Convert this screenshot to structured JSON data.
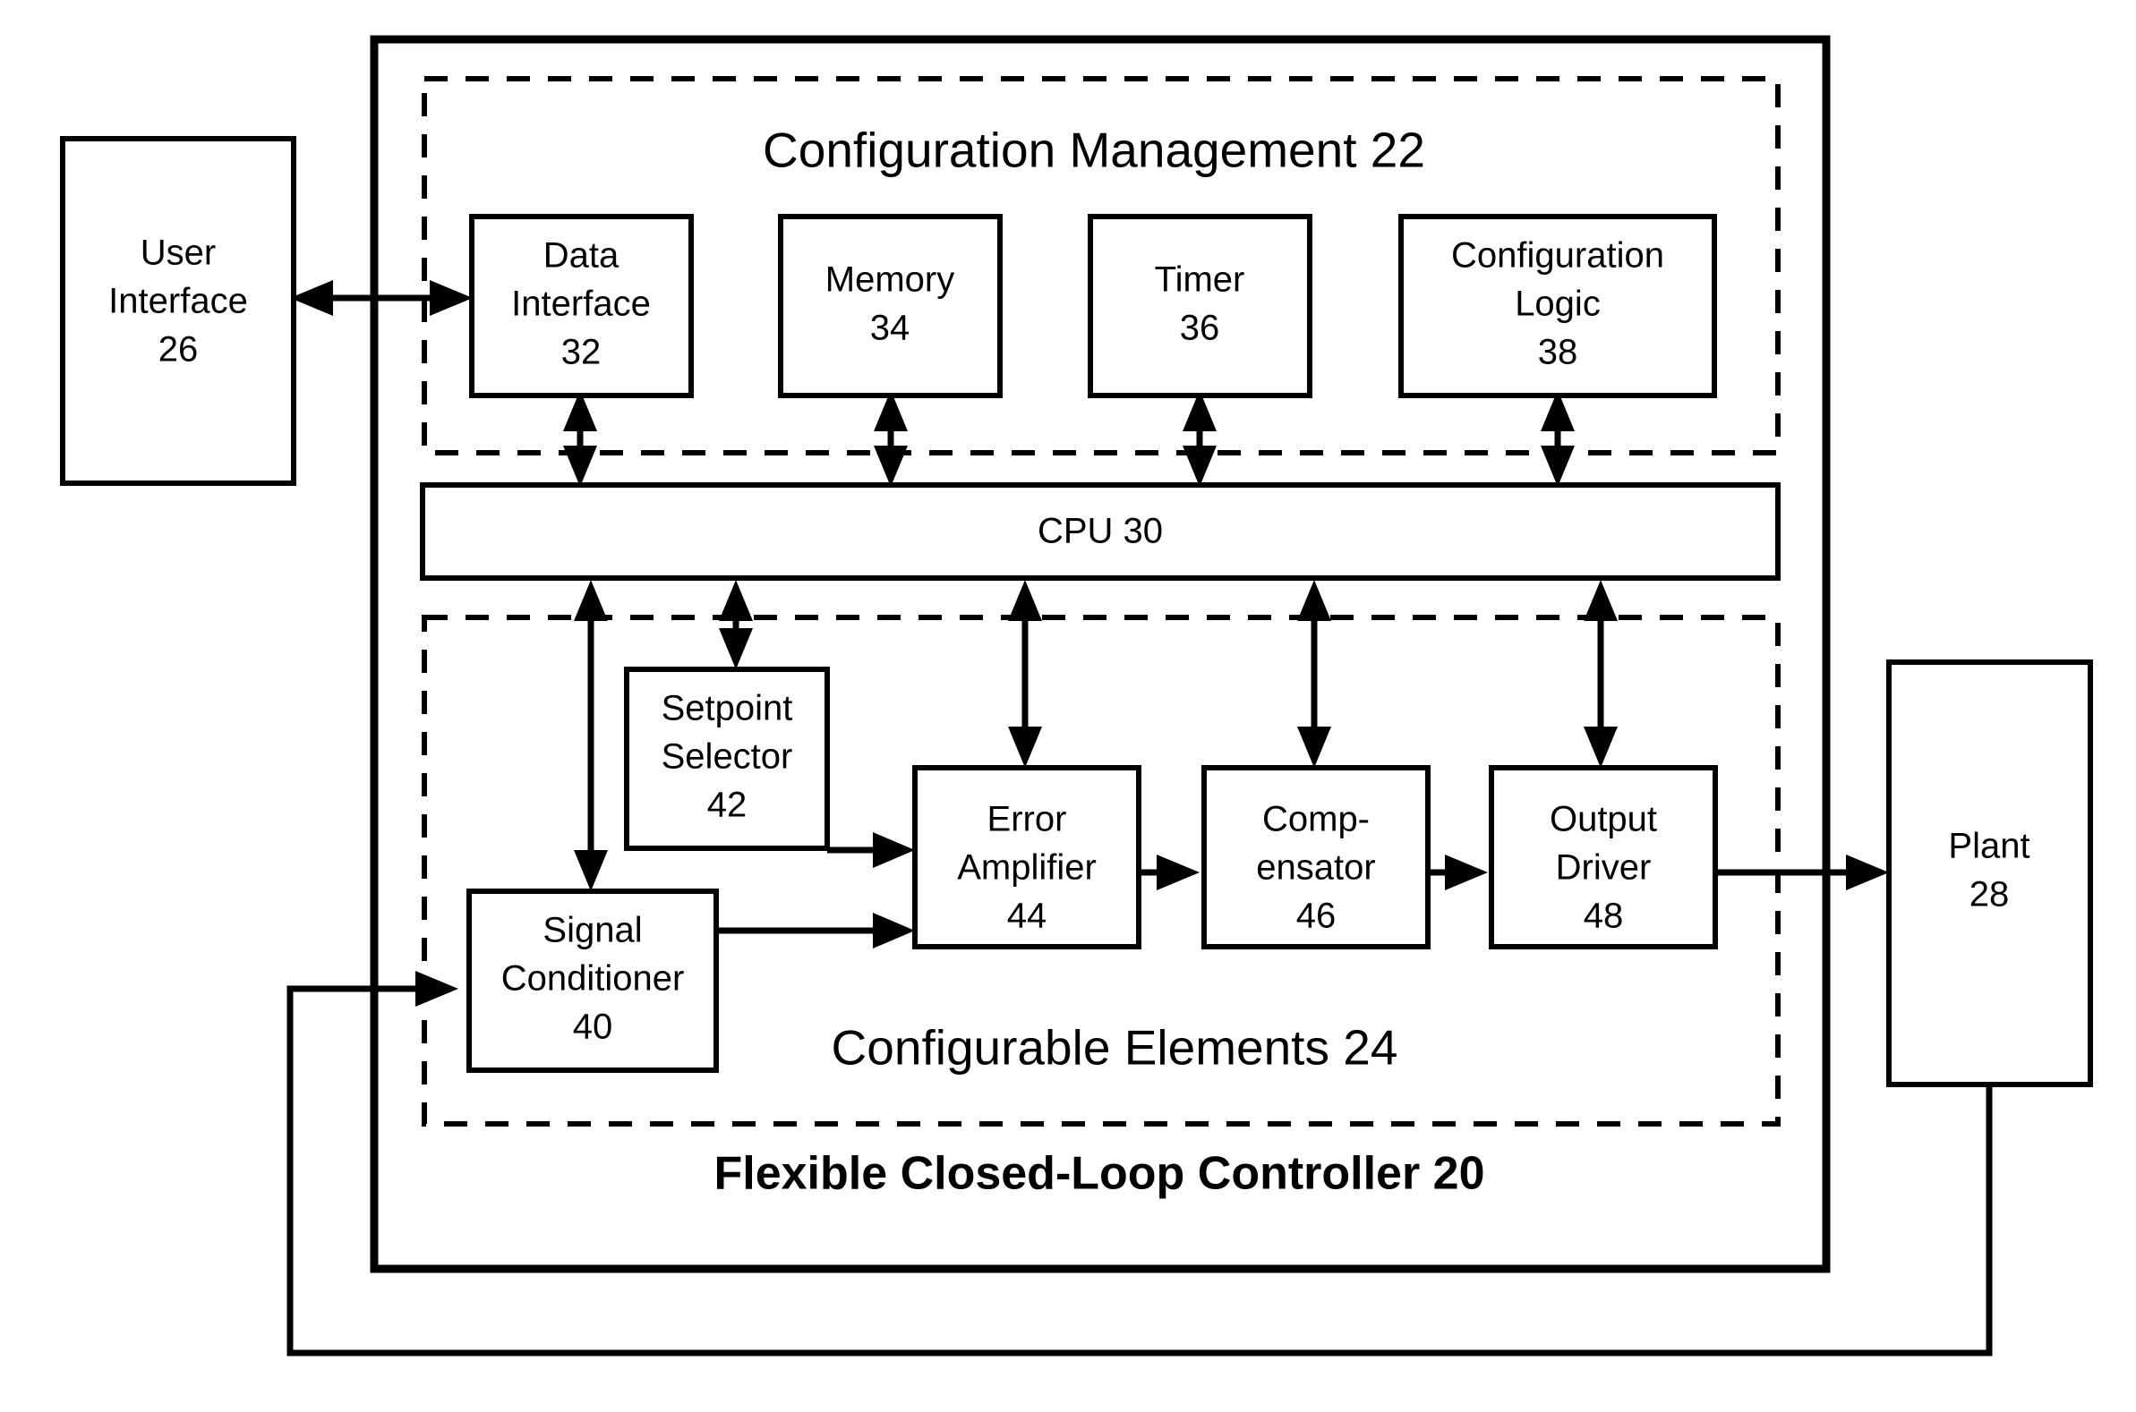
{
  "figure": {
    "title": "Flexible Closed-Loop Controller  20",
    "title_text": "Flexible Closed-Loop Controller",
    "title_ref": "20",
    "background_color": "#ffffff",
    "line_color": "#000000"
  },
  "groups": {
    "configuration_management": {
      "title": "Configuration Management  22",
      "title_text": "Configuration Management",
      "title_ref": "22",
      "border_style": "dashed"
    },
    "configurable_elements": {
      "title": "Configurable Elements  24",
      "title_text": "Configurable Elements",
      "title_ref": "24",
      "border_style": "dashed"
    }
  },
  "external_blocks": [
    {
      "id": "user-interface",
      "line1": "User",
      "line2": "Interface",
      "ref": "26"
    },
    {
      "id": "plant",
      "line1": "Plant",
      "line2": "",
      "ref": "28"
    }
  ],
  "cpu": {
    "id": "cpu",
    "label": "CPU 30",
    "name": "CPU",
    "ref": "30"
  },
  "config_blocks": [
    {
      "id": "data-interface",
      "line1": "Data",
      "line2": "Interface",
      "ref": "32"
    },
    {
      "id": "memory",
      "line1": "Memory",
      "line2": "",
      "ref": "34"
    },
    {
      "id": "timer",
      "line1": "Timer",
      "line2": "",
      "ref": "36"
    },
    {
      "id": "configuration-logic",
      "line1": "Configuration",
      "line2": "Logic",
      "ref": "38"
    }
  ],
  "element_blocks": [
    {
      "id": "signal-conditioner",
      "line1": "Signal",
      "line2": "Conditioner",
      "ref": "40"
    },
    {
      "id": "setpoint-selector",
      "line1": "Setpoint",
      "line2": "Selector",
      "ref": "42"
    },
    {
      "id": "error-amplifier",
      "line1": "Error",
      "line2": "Amplifier",
      "ref": "44"
    },
    {
      "id": "compensator",
      "line1": "Comp-",
      "line2": "ensator",
      "ref": "46"
    },
    {
      "id": "output-driver",
      "line1": "Output",
      "line2": "Driver",
      "ref": "48"
    }
  ]
}
